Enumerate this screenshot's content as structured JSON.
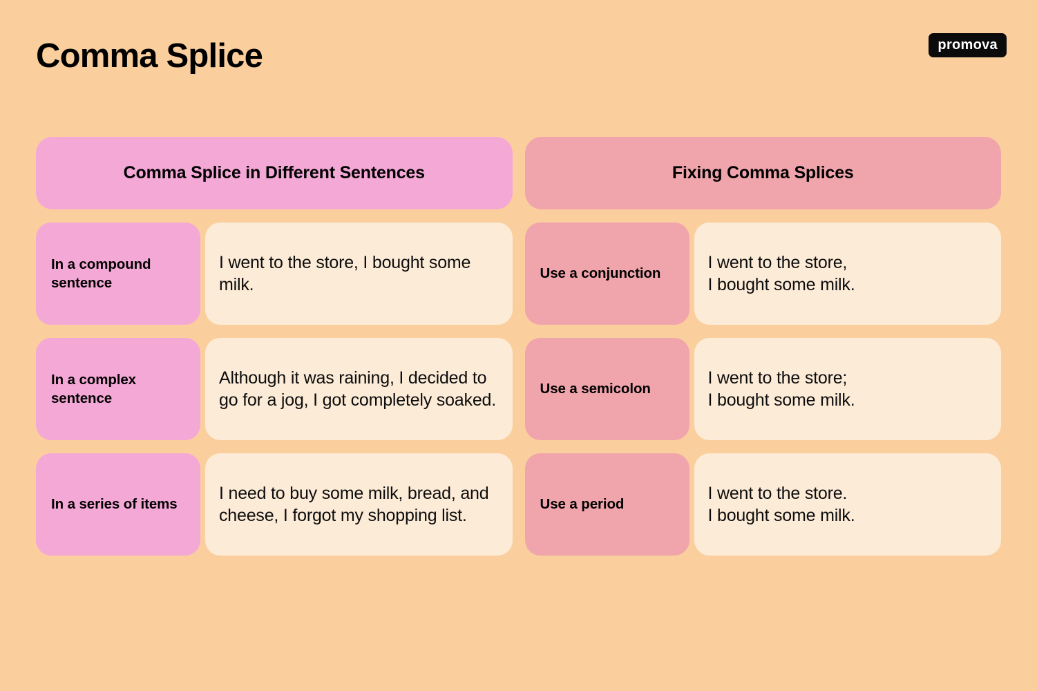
{
  "page": {
    "title": "Comma Splice",
    "background_color": "#FBCF9D",
    "brand": "promova"
  },
  "columns": [
    {
      "key": "splice",
      "header": "Comma Splice in Different Sentences",
      "accent_color": "#F4A8D6",
      "content_color": "#FCEBD7",
      "rows": [
        {
          "label": "In a compound sentence",
          "text": "I went to the store, I bought some milk."
        },
        {
          "label": "In a complex sentence",
          "text": "Although it was raining, I decided to go for a jog, I got completely soaked."
        },
        {
          "label": "In a series of items",
          "text": "I need to buy some milk, bread, and cheese, I forgot my shopping list."
        }
      ]
    },
    {
      "key": "fix",
      "header": "Fixing Comma Splices",
      "accent_color": "#F0A5AC",
      "content_color": "#FCEBD7",
      "rows": [
        {
          "label": "Use a conjunction",
          "text": "I went to the store,\nI bought some milk."
        },
        {
          "label": "Use a semicolon",
          "text": "I went to the store;\nI bought some milk."
        },
        {
          "label": "Use a period",
          "text": "I went to the store.\nI bought some milk."
        }
      ]
    }
  ]
}
